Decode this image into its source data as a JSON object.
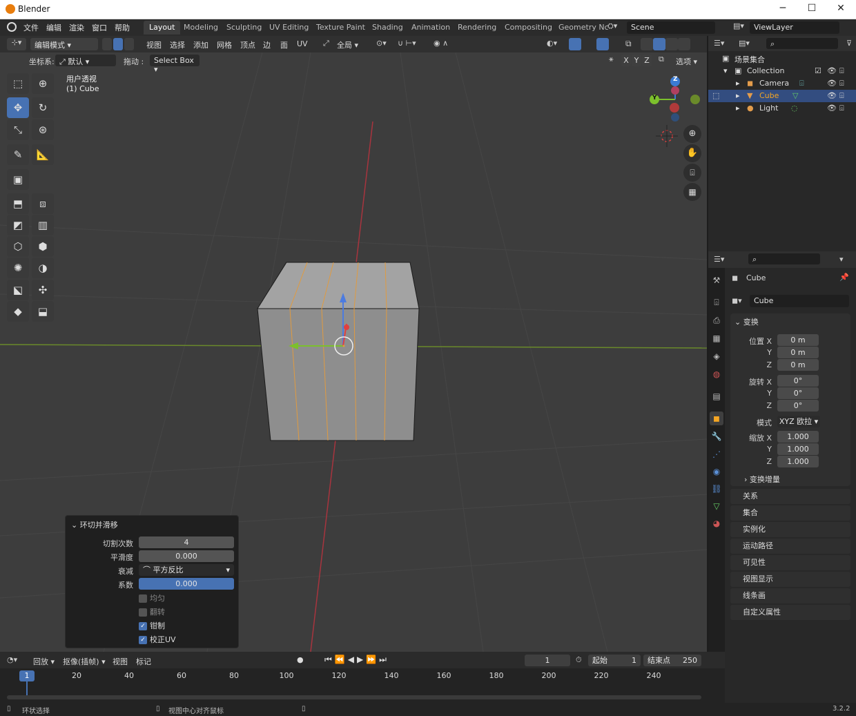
{
  "window": {
    "title": "Blender",
    "min": "─",
    "max": "☐",
    "close": "✕"
  },
  "topbar": {
    "menus": [
      "文件",
      "编辑",
      "渲染",
      "窗口",
      "帮助"
    ],
    "workspaces": [
      "Layout",
      "Modeling",
      "Sculpting",
      "UV Editing",
      "Texture Paint",
      "Shading",
      "Animation",
      "Rendering",
      "Compositing",
      "Geometry Nc"
    ],
    "scene": "Scene",
    "viewlayer": "ViewLayer"
  },
  "viewport_header": {
    "mode": "编辑模式",
    "menus": [
      "视图",
      "选择",
      "添加",
      "网格",
      "顶点",
      "边",
      "面",
      "UV"
    ],
    "transform_orientation": "全局",
    "coord_label": "坐标系:",
    "coord_value": "默认",
    "drag_label": "拖动 :",
    "drag_value": "Select Box",
    "axes": [
      "X",
      "Y",
      "Z"
    ],
    "options": "选项"
  },
  "viewport": {
    "view_name": "用户透视",
    "object_name": "(1) Cube"
  },
  "gizmo": {
    "z": "Z",
    "y": "Y"
  },
  "outliner": {
    "root": "场景集合",
    "collection": "Collection",
    "items": [
      {
        "name": "Camera"
      },
      {
        "name": "Cube"
      },
      {
        "name": "Light"
      }
    ]
  },
  "properties": {
    "object_name": "Cube",
    "mesh_name": "Cube",
    "transform_title": "变换",
    "location": {
      "label": "位置 X",
      "x": "0 m",
      "y": "0 m",
      "z": "0 m"
    },
    "rotation": {
      "label": "旋转 X",
      "x": "0°",
      "y": "0°",
      "z": "0°"
    },
    "mode_label": "模式",
    "mode_value": "XYZ 欧拉",
    "scale": {
      "label": "缩放 X",
      "x": "1.000",
      "y": "1.000",
      "z": "1.000"
    },
    "y_label": "Y",
    "z_label": "Z",
    "delta": "变换增量",
    "sections": [
      "关系",
      "集合",
      "实例化",
      "运动路径",
      "可见性",
      "视图显示",
      "线条画",
      "自定义属性"
    ]
  },
  "redo_panel": {
    "title": "环切并滑移",
    "cuts_label": "切割次数",
    "cuts": "4",
    "smooth_label": "平滑度",
    "smooth": "0.000",
    "falloff_label": "衰减",
    "falloff": "平方反比",
    "factor_label": "系数",
    "factor": "0.000",
    "even": "均匀",
    "flip": "翻转",
    "clamp": "钳制",
    "correct_uv": "校正UV"
  },
  "timeline": {
    "menus": [
      "回放",
      "抠像(插帧)",
      "视图",
      "标记"
    ],
    "current_frame": "1",
    "start_label": "起始",
    "start": "1",
    "end_label": "结束点",
    "end": "250",
    "ticks": [
      "20",
      "40",
      "60",
      "80",
      "100",
      "120",
      "140",
      "160",
      "180",
      "200",
      "220",
      "240"
    ],
    "marker": "1"
  },
  "status": {
    "left": "环状选择",
    "middle": "视图中心对齐鼠标",
    "version": "3.2.2"
  }
}
